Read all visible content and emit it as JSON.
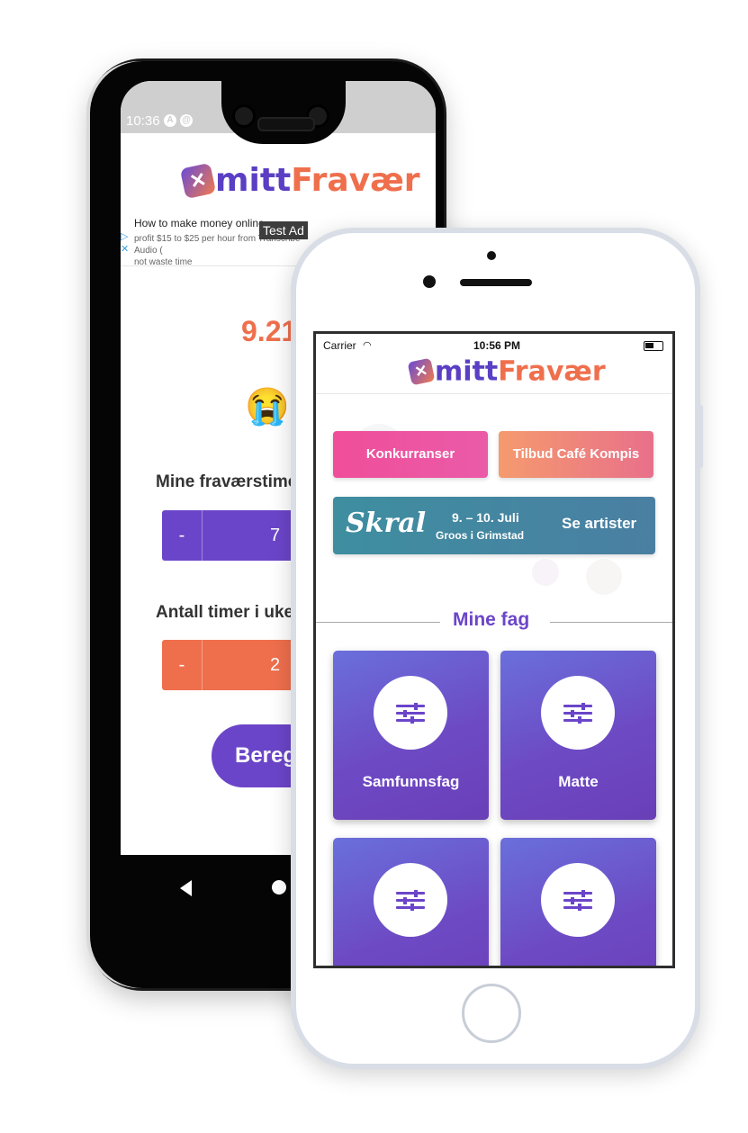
{
  "android": {
    "status_time": "10:36",
    "logo_prefix": "mitt",
    "logo_suffix": "Fravær",
    "ad": {
      "title": "How to make money online",
      "subtitle": "profit $15 to $25 per hour from Transcribe Audio (",
      "subtitle2": "not waste time",
      "badge": "Test Ad"
    },
    "big_number": "9.21",
    "emoji": "😭😩",
    "label_hours": "Mine fraværstimer",
    "stepper1": {
      "minus": "-",
      "value": "7"
    },
    "label_week": "Antall timer i uken i",
    "stepper2": {
      "minus": "-",
      "value": "2"
    },
    "calc_button": "Beregn"
  },
  "iphone": {
    "status": {
      "carrier": "Carrier",
      "time": "10:56 PM"
    },
    "logo_prefix": "mitt",
    "logo_suffix": "Fravær",
    "buttons": {
      "competitions": "Konkurranser",
      "cafe": "Tilbud Café Kompis"
    },
    "banner": {
      "logo": "Skral",
      "date": "9. – 10. Juli",
      "place": "Groos i Grimstad",
      "cta": "Se artister"
    },
    "section_title": "Mine fag",
    "subjects": [
      {
        "label": "Samfunnsfag",
        "icon": "sliders-icon"
      },
      {
        "label": "Matte",
        "icon": "sliders-icon"
      },
      {
        "label": "",
        "icon": "sliders-icon"
      },
      {
        "label": "",
        "icon": "sliders-icon"
      }
    ]
  },
  "colors": {
    "brand_purple": "#6b45c9",
    "brand_orange": "#ef6f4d",
    "pink": "#f04e9a",
    "teal": "#3e8ea0"
  }
}
